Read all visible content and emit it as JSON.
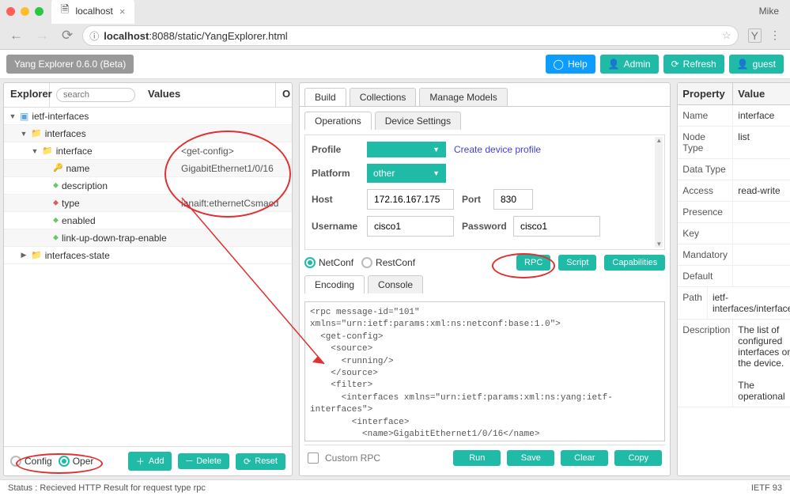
{
  "browser": {
    "tab_title": "localhost",
    "user": "Mike",
    "url_host": "localhost",
    "url_rest": ":8088/static/YangExplorer.html"
  },
  "header": {
    "app_badge": "Yang Explorer 0.6.0 (Beta)",
    "help": "Help",
    "admin": "Admin",
    "refresh": "Refresh",
    "guest": "guest"
  },
  "explorer": {
    "title": "Explorer",
    "search_placeholder": "search",
    "values_title": "Values",
    "o_title": "O",
    "tree": [
      {
        "indent": 0,
        "tw": "▼",
        "icon": "R",
        "label": "ietf-interfaces",
        "val": ""
      },
      {
        "indent": 1,
        "tw": "▼",
        "icon": "folder",
        "label": "interfaces",
        "val": ""
      },
      {
        "indent": 2,
        "tw": "▼",
        "icon": "folder",
        "label": "interface",
        "val": "<get-config>"
      },
      {
        "indent": 3,
        "tw": "",
        "icon": "key",
        "label": "name",
        "val": "GigabitEthernet1/0/16"
      },
      {
        "indent": 3,
        "tw": "",
        "icon": "leaf",
        "label": "description",
        "val": ""
      },
      {
        "indent": 3,
        "tw": "",
        "icon": "leaf-red",
        "label": "type",
        "val": "ianaift:ethernetCsmacd"
      },
      {
        "indent": 3,
        "tw": "",
        "icon": "leaf",
        "label": "enabled",
        "val": ""
      },
      {
        "indent": 3,
        "tw": "",
        "icon": "leaf",
        "label": "link-up-down-trap-enable",
        "val": ""
      },
      {
        "indent": 1,
        "tw": "▶",
        "icon": "folder",
        "label": "interfaces-state",
        "val": ""
      }
    ],
    "config": "Config",
    "oper": "Oper",
    "add": "Add",
    "delete": "Delete",
    "reset": "Reset"
  },
  "mid": {
    "tabs": [
      "Build",
      "Collections",
      "Manage Models"
    ],
    "subtabs": [
      "Operations",
      "Device Settings"
    ],
    "profile_label": "Profile",
    "create_profile": "Create device profile",
    "platform_label": "Platform",
    "platform_value": "other",
    "host_label": "Host",
    "host_value": "172.16.167.175",
    "port_label": "Port",
    "port_value": "830",
    "user_label": "Username",
    "user_value": "cisco1",
    "pass_label": "Password",
    "pass_value": "cisco1",
    "netconf": "NetConf",
    "restconf": "RestConf",
    "rpc": "RPC",
    "script": "Script",
    "capabilities": "Capabilities",
    "codetabs": [
      "Encoding",
      "Console"
    ],
    "rpc_code": "<rpc message-id=\"101\"\nxmlns=\"urn:ietf:params:xml:ns:netconf:base:1.0\">\n  <get-config>\n    <source>\n      <running/>\n    </source>\n    <filter>\n      <interfaces xmlns=\"urn:ietf:params:xml:ns:yang:ietf-\ninterfaces\">\n        <interface>\n          <name>GigabitEthernet1/0/16</name>\n          <type xmlns:ianaift=\"urn:ietf:params:xml:ns:yang:iana-if-\ntype\">ianaift:ethernetCsmacd</type>\n        </interface>\n      </interfaces>",
    "custom_rpc": "Custom RPC",
    "run": "Run",
    "save": "Save",
    "clear": "Clear",
    "copy": "Copy"
  },
  "props": {
    "head_k": "Property",
    "head_v": "Value",
    "rows": [
      [
        "Name",
        "interface"
      ],
      [
        "Node Type",
        "list"
      ],
      [
        "Data Type",
        ""
      ],
      [
        "Access",
        "read-write"
      ],
      [
        "Presence",
        ""
      ],
      [
        "Key",
        ""
      ],
      [
        "Mandatory",
        ""
      ],
      [
        "Default",
        ""
      ],
      [
        "Path",
        "ietf-interfaces/interfaces/interface"
      ],
      [
        "Description",
        "The list of configured interfaces on the device.\n\nThe operational"
      ]
    ]
  },
  "status": {
    "left": "Status : Recieved HTTP Result for request type rpc",
    "right": "IETF 93"
  }
}
